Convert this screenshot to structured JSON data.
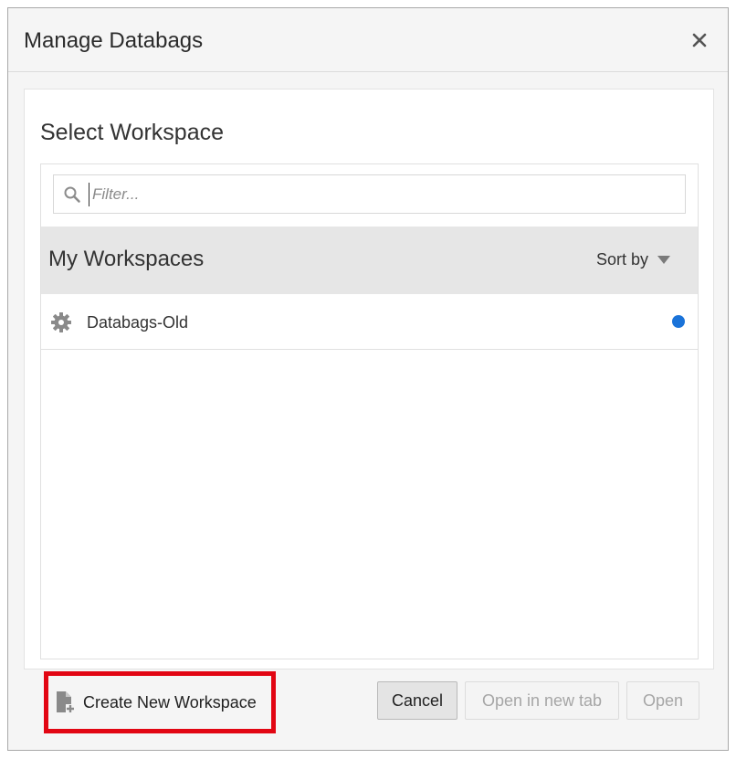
{
  "dialog": {
    "title": "Manage Databags",
    "close_icon": "close-icon"
  },
  "main": {
    "section_title": "Select Workspace",
    "filter": {
      "placeholder": "Filter...",
      "value": ""
    },
    "group": {
      "title": "My Workspaces",
      "sort_label": "Sort by"
    },
    "workspaces": [
      {
        "name": "Databags-Old",
        "icon": "gear-icon",
        "status_color": "#1a73d9"
      }
    ]
  },
  "footer": {
    "create_label": "Create New Workspace",
    "cancel_label": "Cancel",
    "open_new_tab_label": "Open in new tab",
    "open_label": "Open",
    "highlight_color": "#e20613"
  }
}
